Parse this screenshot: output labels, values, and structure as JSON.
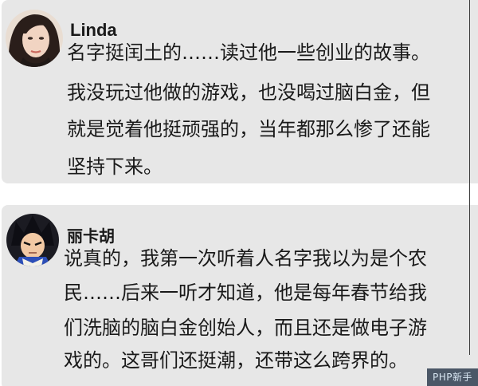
{
  "comments": [
    {
      "username": "Linda",
      "lines": [
        "名字挺闰土的……读过他一些创业的故事。",
        "我没玩过他做的游戏，也没喝过脑白金，但",
        "就是觉着他挺顽强的，当年都那么惨了还能",
        "坚持下来。"
      ]
    },
    {
      "username": "丽卡胡",
      "lines": [
        "说真的，我第一次听着人名字我以为是个农",
        "民……后来一听才知道，他是每年春节给我",
        "们洗脑的脑白金创始人，而且还是做电子游",
        "戏的。这哥们还挺潮，还带这么跨界的。"
      ]
    }
  ],
  "watermark": "PHP新手"
}
